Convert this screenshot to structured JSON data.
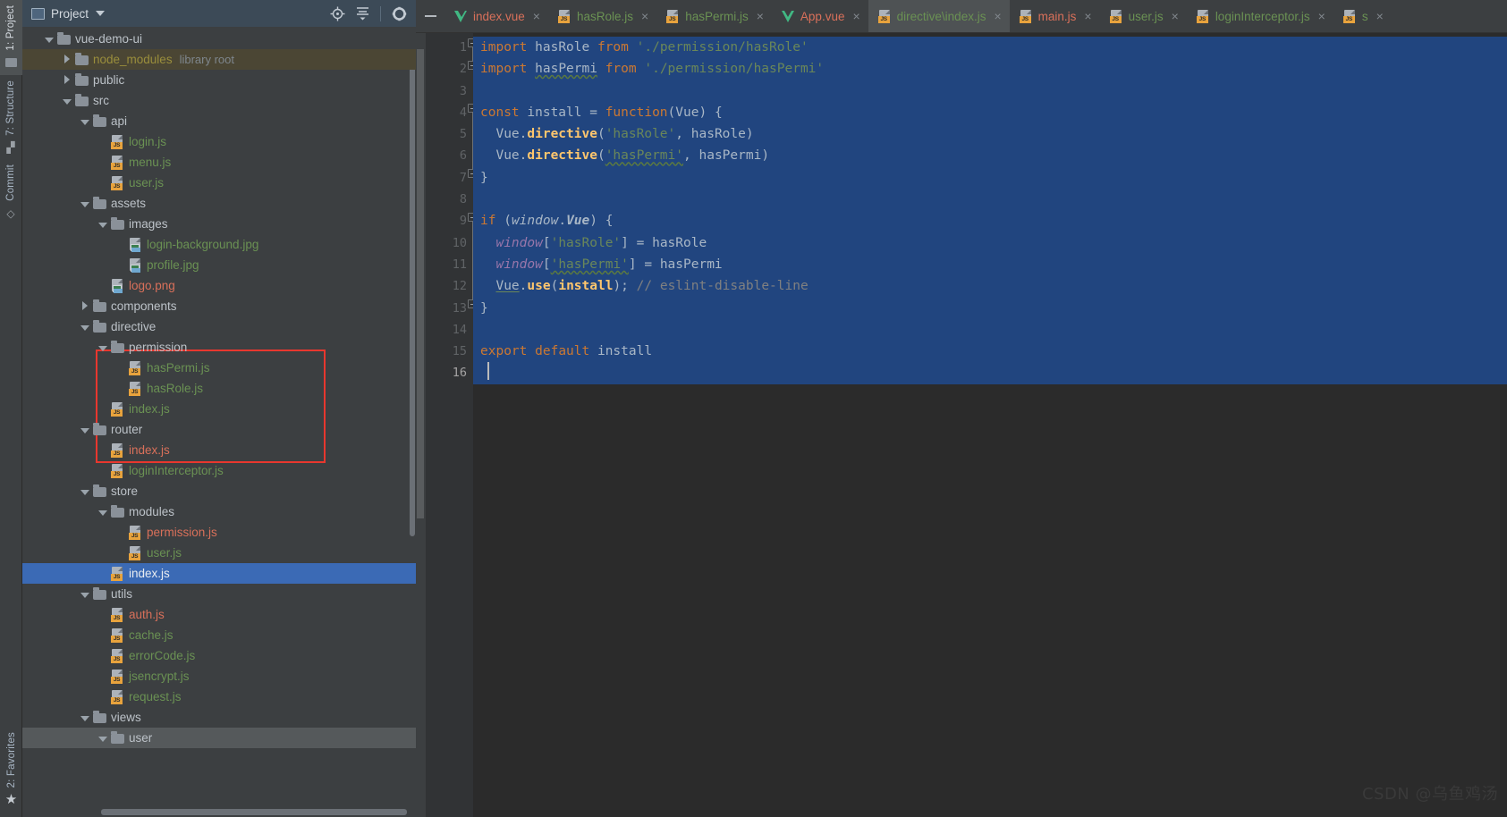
{
  "toolstrip": {
    "items": [
      {
        "label": "1: Project",
        "icon": "project-folder-icon",
        "active": true
      },
      {
        "label": "7: Structure",
        "icon": "structure-icon",
        "active": false
      },
      {
        "label": "Commit",
        "icon": "commit-icon",
        "active": false
      }
    ],
    "bottom": {
      "label": "2: Favorites",
      "icon": "star-icon"
    }
  },
  "project_panel": {
    "title": "Project",
    "icons": [
      "locate-target-icon",
      "collapse-all-icon",
      "gear-icon",
      "minimize-icon"
    ],
    "tree": [
      {
        "depth": 0,
        "arrow": "down",
        "icon": "folder",
        "name": "vue-demo-ui",
        "color": "grey",
        "suffix": ""
      },
      {
        "depth": 1,
        "arrow": "right",
        "icon": "folder",
        "name": "node_modules",
        "color": "olive",
        "suffix": "library root",
        "row": "lib"
      },
      {
        "depth": 1,
        "arrow": "right",
        "icon": "folder",
        "name": "public",
        "color": "grey",
        "suffix": ""
      },
      {
        "depth": 1,
        "arrow": "down",
        "icon": "folder",
        "name": "src",
        "color": "grey",
        "suffix": ""
      },
      {
        "depth": 2,
        "arrow": "down",
        "icon": "folder",
        "name": "api",
        "color": "grey",
        "suffix": ""
      },
      {
        "depth": 3,
        "arrow": "none",
        "icon": "js",
        "name": "login.js",
        "color": "green",
        "suffix": ""
      },
      {
        "depth": 3,
        "arrow": "none",
        "icon": "js",
        "name": "menu.js",
        "color": "green",
        "suffix": ""
      },
      {
        "depth": 3,
        "arrow": "none",
        "icon": "js",
        "name": "user.js",
        "color": "green",
        "suffix": ""
      },
      {
        "depth": 2,
        "arrow": "down",
        "icon": "folder",
        "name": "assets",
        "color": "grey",
        "suffix": ""
      },
      {
        "depth": 3,
        "arrow": "down",
        "icon": "folder",
        "name": "images",
        "color": "grey",
        "suffix": ""
      },
      {
        "depth": 4,
        "arrow": "none",
        "icon": "img",
        "name": "login-background.jpg",
        "color": "green",
        "suffix": ""
      },
      {
        "depth": 4,
        "arrow": "none",
        "icon": "img",
        "name": "profile.jpg",
        "color": "green",
        "suffix": ""
      },
      {
        "depth": 3,
        "arrow": "none",
        "icon": "img",
        "name": "logo.png",
        "color": "red",
        "suffix": ""
      },
      {
        "depth": 2,
        "arrow": "right",
        "icon": "folder",
        "name": "components",
        "color": "grey",
        "suffix": ""
      },
      {
        "depth": 2,
        "arrow": "down",
        "icon": "folder",
        "name": "directive",
        "color": "grey",
        "suffix": ""
      },
      {
        "depth": 3,
        "arrow": "down",
        "icon": "folder",
        "name": "permission",
        "color": "grey",
        "suffix": ""
      },
      {
        "depth": 4,
        "arrow": "none",
        "icon": "js",
        "name": "hasPermi.js",
        "color": "green",
        "suffix": ""
      },
      {
        "depth": 4,
        "arrow": "none",
        "icon": "js",
        "name": "hasRole.js",
        "color": "green",
        "suffix": ""
      },
      {
        "depth": 3,
        "arrow": "none",
        "icon": "js",
        "name": "index.js",
        "color": "green",
        "suffix": ""
      },
      {
        "depth": 2,
        "arrow": "down",
        "icon": "folder",
        "name": "router",
        "color": "grey",
        "suffix": ""
      },
      {
        "depth": 3,
        "arrow": "none",
        "icon": "js",
        "name": "index.js",
        "color": "red",
        "suffix": ""
      },
      {
        "depth": 3,
        "arrow": "none",
        "icon": "js",
        "name": "loginInterceptor.js",
        "color": "green",
        "suffix": ""
      },
      {
        "depth": 2,
        "arrow": "down",
        "icon": "folder",
        "name": "store",
        "color": "grey",
        "suffix": ""
      },
      {
        "depth": 3,
        "arrow": "down",
        "icon": "folder",
        "name": "modules",
        "color": "grey",
        "suffix": ""
      },
      {
        "depth": 4,
        "arrow": "none",
        "icon": "js",
        "name": "permission.js",
        "color": "red",
        "suffix": ""
      },
      {
        "depth": 4,
        "arrow": "none",
        "icon": "js",
        "name": "user.js",
        "color": "green",
        "suffix": ""
      },
      {
        "depth": 3,
        "arrow": "none",
        "icon": "js",
        "name": "index.js",
        "color": "grey",
        "suffix": "",
        "row": "sel"
      },
      {
        "depth": 2,
        "arrow": "down",
        "icon": "folder",
        "name": "utils",
        "color": "grey",
        "suffix": ""
      },
      {
        "depth": 3,
        "arrow": "none",
        "icon": "js",
        "name": "auth.js",
        "color": "red",
        "suffix": ""
      },
      {
        "depth": 3,
        "arrow": "none",
        "icon": "js",
        "name": "cache.js",
        "color": "green",
        "suffix": ""
      },
      {
        "depth": 3,
        "arrow": "none",
        "icon": "js",
        "name": "errorCode.js",
        "color": "green",
        "suffix": ""
      },
      {
        "depth": 3,
        "arrow": "none",
        "icon": "js",
        "name": "jsencrypt.js",
        "color": "green",
        "suffix": ""
      },
      {
        "depth": 3,
        "arrow": "none",
        "icon": "js",
        "name": "request.js",
        "color": "green",
        "suffix": ""
      },
      {
        "depth": 2,
        "arrow": "down",
        "icon": "folder",
        "name": "views",
        "color": "grey",
        "suffix": ""
      },
      {
        "depth": 3,
        "arrow": "down",
        "icon": "folder",
        "name": "user",
        "color": "grey",
        "suffix": "",
        "row": "bottom"
      }
    ]
  },
  "editor": {
    "tabs": [
      {
        "label": "index.vue",
        "icon": "vue",
        "color": "red",
        "active": false
      },
      {
        "label": "hasRole.js",
        "icon": "js",
        "color": "green",
        "active": false
      },
      {
        "label": "hasPermi.js",
        "icon": "js",
        "color": "green",
        "active": false
      },
      {
        "label": "App.vue",
        "icon": "vue",
        "color": "red",
        "active": false
      },
      {
        "label": "directive\\index.js",
        "icon": "js",
        "color": "green",
        "active": true
      },
      {
        "label": "main.js",
        "icon": "js",
        "color": "red",
        "active": false
      },
      {
        "label": "user.js",
        "icon": "js",
        "color": "green",
        "active": false
      },
      {
        "label": "loginInterceptor.js",
        "icon": "js",
        "color": "green",
        "active": false
      },
      {
        "label": "s",
        "icon": "js",
        "color": "green",
        "active": false
      }
    ],
    "close_glyph": "×",
    "line_numbers": [
      "1",
      "2",
      "3",
      "4",
      "5",
      "6",
      "7",
      "8",
      "9",
      "10",
      "11",
      "12",
      "13",
      "14",
      "15",
      "16"
    ],
    "current_line": "16",
    "code": [
      "import hasRole from './permission/hasRole'",
      "import hasPermi from './permission/hasPermi'",
      "",
      "const install = function(Vue) {",
      "  Vue.directive('hasRole', hasRole)",
      "  Vue.directive('hasPermi', hasPermi)",
      "}",
      "",
      "if (window.Vue) {",
      "  window['hasRole'] = hasRole",
      "  window['hasPermi'] = hasPermi",
      "  Vue.use(install); // eslint-disable-line",
      "}",
      "",
      "export default install",
      ""
    ]
  },
  "watermark": "CSDN @乌鱼鸡汤",
  "colors": {
    "selection_blue": "#21457f",
    "annotation_red": "#e8372e",
    "tree_selected": "#3b6ab5",
    "library_root": "#4b4634",
    "panel_bg": "#3c3f41",
    "editor_bg": "#2b2b2b",
    "gutter_bg": "#313335"
  }
}
